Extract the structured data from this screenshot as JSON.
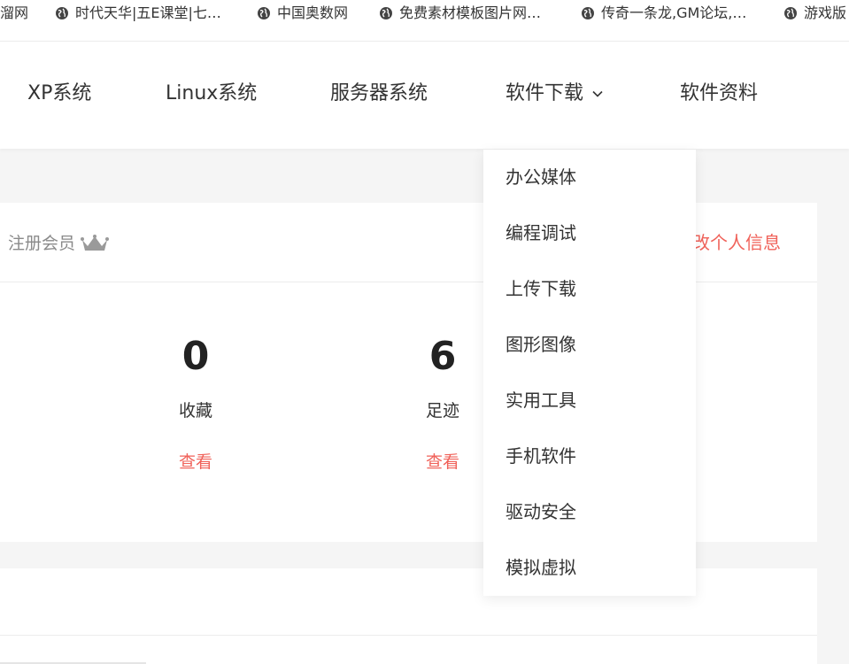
{
  "bookmarks": [
    {
      "label": "溜网",
      "icon": "none"
    },
    {
      "label": "时代天华|五E课堂|七…",
      "icon": "globe-icon"
    },
    {
      "label": "中国奥数网",
      "icon": "globe-icon"
    },
    {
      "label": "免费素材模板图片网…",
      "icon": "globe-icon"
    },
    {
      "label": "传奇一条龙,GM论坛,…",
      "icon": "globe-icon"
    },
    {
      "label": "游戏版",
      "icon": "globe-icon"
    }
  ],
  "nav": {
    "items": [
      "XP系统",
      "Linux系统",
      "服务器系统",
      "软件下载",
      "软件资料"
    ],
    "active_dropdown": "软件下载"
  },
  "dropdown": {
    "items": [
      "办公媒体",
      "编程调试",
      "上传下载",
      "图形图像",
      "实用工具",
      "手机软件",
      "驱动安全",
      "模拟虚拟"
    ]
  },
  "user_card": {
    "member_label": "注册会员",
    "edit_label": "改个人信息",
    "stats": [
      {
        "value": "0",
        "label": "收藏",
        "link": "查看"
      },
      {
        "value": "6",
        "label": "足迹",
        "link": "查看"
      }
    ]
  },
  "colors": {
    "accent": "#f0625a",
    "text": "#333333",
    "muted": "#8a8a8a",
    "background": "#f5f5f5"
  }
}
